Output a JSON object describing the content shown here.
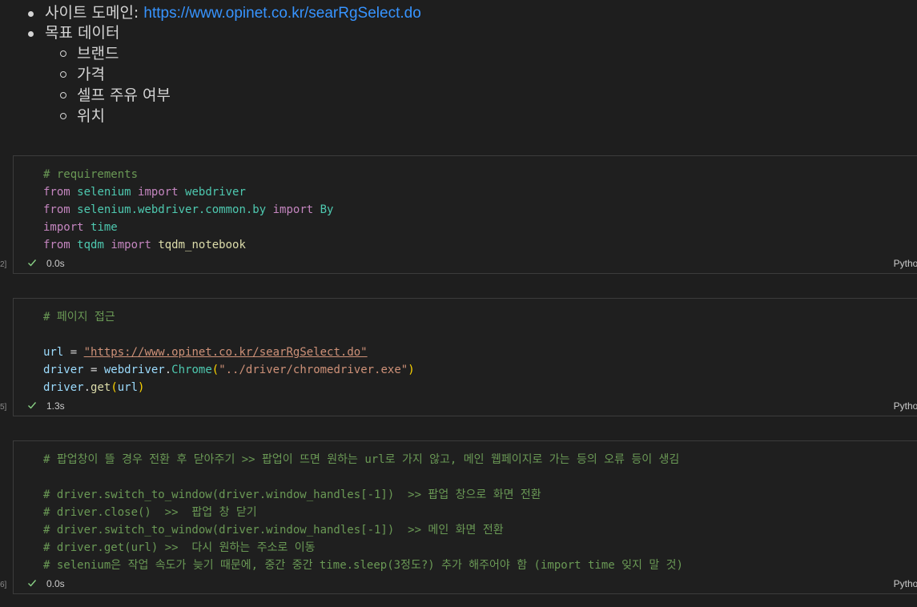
{
  "markdown": {
    "domain_label": "사이트 도메인: ",
    "domain_link": "https://www.opinet.co.kr/searRgSelect.do",
    "target_label": "목표 데이터",
    "targets": [
      "브랜드",
      "가격",
      "셀프 주유 여부",
      "위치"
    ]
  },
  "cells": [
    {
      "exec_count": "2]",
      "lines": [
        [
          {
            "t": "# requirements",
            "c": "comment"
          }
        ],
        [
          {
            "t": "from",
            "c": "kw"
          },
          {
            "t": " ",
            "c": "op"
          },
          {
            "t": "selenium",
            "c": "mod"
          },
          {
            "t": " ",
            "c": "op"
          },
          {
            "t": "import",
            "c": "kw"
          },
          {
            "t": " ",
            "c": "op"
          },
          {
            "t": "webdriver",
            "c": "mod"
          }
        ],
        [
          {
            "t": "from",
            "c": "kw"
          },
          {
            "t": " ",
            "c": "op"
          },
          {
            "t": "selenium.webdriver.common.by",
            "c": "mod"
          },
          {
            "t": " ",
            "c": "op"
          },
          {
            "t": "import",
            "c": "kw"
          },
          {
            "t": " ",
            "c": "op"
          },
          {
            "t": "By",
            "c": "mod"
          }
        ],
        [
          {
            "t": "import",
            "c": "kw"
          },
          {
            "t": " ",
            "c": "op"
          },
          {
            "t": "time",
            "c": "mod"
          }
        ],
        [
          {
            "t": "from",
            "c": "kw"
          },
          {
            "t": " ",
            "c": "op"
          },
          {
            "t": "tqdm",
            "c": "mod"
          },
          {
            "t": " ",
            "c": "op"
          },
          {
            "t": "import",
            "c": "kw"
          },
          {
            "t": " ",
            "c": "op"
          },
          {
            "t": "tqdm_notebook",
            "c": "fn"
          }
        ]
      ],
      "time": "0.0s",
      "language": "Python"
    },
    {
      "exec_count": "5]",
      "lines": [
        [
          {
            "t": "# 페이지 접근",
            "c": "comment"
          }
        ],
        [],
        [
          {
            "t": "url",
            "c": "var"
          },
          {
            "t": " = ",
            "c": "op"
          },
          {
            "t": "\"https://www.opinet.co.kr/searRgSelect.do\"",
            "c": "str-u"
          }
        ],
        [
          {
            "t": "driver",
            "c": "var"
          },
          {
            "t": " = ",
            "c": "op"
          },
          {
            "t": "webdriver",
            "c": "var"
          },
          {
            "t": ".",
            "c": "op"
          },
          {
            "t": "Chrome",
            "c": "mod"
          },
          {
            "t": "(",
            "c": "paren"
          },
          {
            "t": "\"../driver/chromedriver.exe\"",
            "c": "str"
          },
          {
            "t": ")",
            "c": "paren"
          }
        ],
        [
          {
            "t": "driver",
            "c": "var"
          },
          {
            "t": ".",
            "c": "op"
          },
          {
            "t": "get",
            "c": "fn"
          },
          {
            "t": "(",
            "c": "paren"
          },
          {
            "t": "url",
            "c": "var"
          },
          {
            "t": ")",
            "c": "paren"
          }
        ]
      ],
      "time": "1.3s",
      "language": "Python"
    },
    {
      "exec_count": "6]",
      "lines": [
        [
          {
            "t": "# 팝업창이 뜰 경우 전환 후 닫아주기 >> 팝업이 뜨면 원하는 url로 가지 않고, 메인 웹페이지로 가는 등의 오류 등이 생김",
            "c": "comment"
          }
        ],
        [],
        [
          {
            "t": "# driver.switch_to_window(driver.window_handles[-1])  >> 팝업 창으로 화면 전환",
            "c": "comment"
          }
        ],
        [
          {
            "t": "# driver.close()  >>  팝업 창 닫기",
            "c": "comment"
          }
        ],
        [
          {
            "t": "# driver.switch_to_window(driver.window_handles[-1])  >> 메인 화면 전환",
            "c": "comment"
          }
        ],
        [
          {
            "t": "# driver.get(url) >>  다시 원하는 주소로 이동",
            "c": "comment"
          }
        ],
        [
          {
            "t": "# selenium은 작업 속도가 늦기 때문에, 중간 중간 time.sleep(3정도?) 추가 해주어야 함 (import time 잊지 말 것)",
            "c": "comment"
          }
        ]
      ],
      "time": "0.0s",
      "language": "Python"
    }
  ],
  "icons": {
    "status_ok": "check-icon"
  },
  "colors": {
    "background": "#1e1e1e",
    "link": "#3794ff",
    "comment": "#6a9955",
    "keyword": "#c586c0",
    "module": "#4ec9b0",
    "check": "#89d185"
  }
}
